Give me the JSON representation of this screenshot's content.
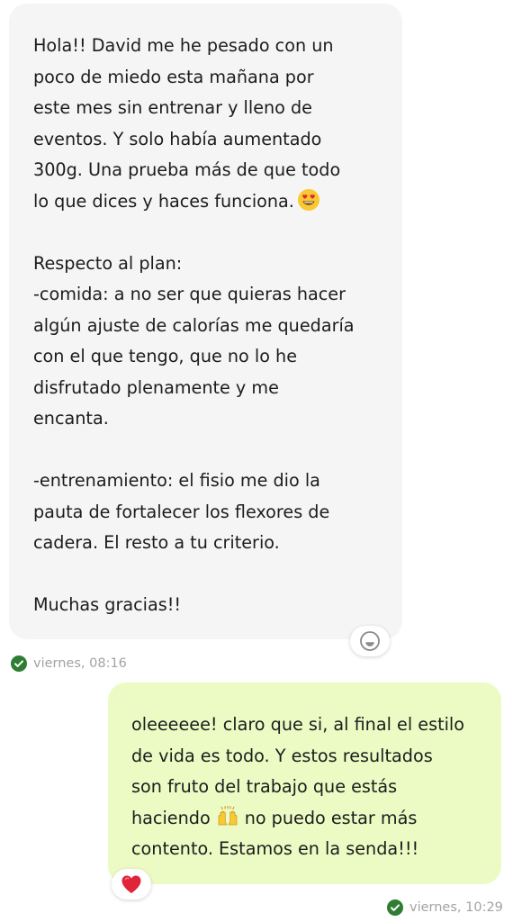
{
  "incoming_message": {
    "lines": [
      "Hola!! David me he pesado con un",
      "poco de miedo esta mañana por",
      "este mes sin entrenar y lleno de",
      "eventos. Y solo había aumentado",
      "300g. Una prueba más de que todo",
      "lo que dices y haces funciona.",
      "",
      "Respecto al plan:",
      "-comida: a no ser que quieras hacer",
      "algún ajuste de calorías me quedaría",
      "con el que tengo, que no lo he",
      "disfrutado plenamente y me",
      "encanta.",
      "",
      "-entrenamiento: el fisio me dio la",
      "pauta de fortalecer los flexores de",
      "cadera. El resto a tu criterio.",
      "",
      "Muchas gracias!!"
    ],
    "emoji_icon": "heart-eyes-emoji-icon",
    "reaction_icon": "add-reaction-smiley-icon",
    "timestamp": "viernes, 08:16",
    "status_icon": "delivered-check-icon"
  },
  "outgoing_message": {
    "lines": [
      "oleeeeee! claro que si, al final el estilo",
      "de vida es todo. Y estos resultados",
      "son fruto del trabajo que estás",
      "haciendo",
      "no puedo estar más",
      "contento. Estamos en la senda!!!"
    ],
    "emoji_icon": "raising-hands-emoji-icon",
    "reaction_icon": "red-heart-icon",
    "timestamp": "viernes, 10:29",
    "status_icon": "delivered-check-icon"
  },
  "colors": {
    "incoming_bubble": "#f5f5f5",
    "outgoing_bubble": "#ecfbc4",
    "check_green": "#2e7d32",
    "timestamp_gray": "#a3a3a3",
    "heart_red": "#e0243a"
  }
}
